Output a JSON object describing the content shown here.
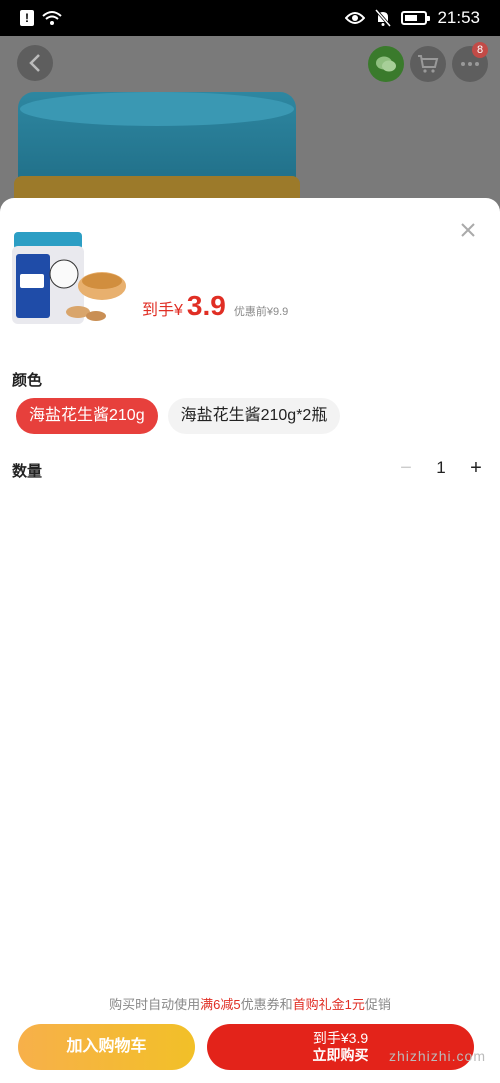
{
  "status_bar": {
    "time": "21:53",
    "icons": [
      "alert-icon",
      "wifi-icon",
      "eye-icon",
      "bell-off-icon",
      "battery-icon"
    ]
  },
  "background": {
    "cart_badge": "8",
    "icons": [
      "back-icon",
      "wechat-icon",
      "cart-icon",
      "more-icon"
    ]
  },
  "sheet": {
    "price_prefix": "到手¥",
    "price_value": "3.9",
    "original_price": "优惠前¥9.9",
    "color_label": "颜色",
    "options": [
      "海盐花生酱210g",
      "海盐花生酱210g*2瓶"
    ],
    "quantity_label": "数量",
    "quantity_value": "1",
    "promo_prefix": "购买时自动使用",
    "promo_hl1": "满6减5",
    "promo_mid": "优惠券和",
    "promo_hl2": "首购礼金1元",
    "promo_suffix": "促销",
    "add_to_cart": "加入购物车",
    "buy_line1": "到手¥3.9",
    "buy_line2": "立即购买"
  },
  "watermark": "zhizhizhi.com",
  "colors": {
    "accent_red": "#e02e24",
    "selected_option": "#e7403c",
    "cart_button": "#f7b04a",
    "buy_button": "#e3231a"
  }
}
